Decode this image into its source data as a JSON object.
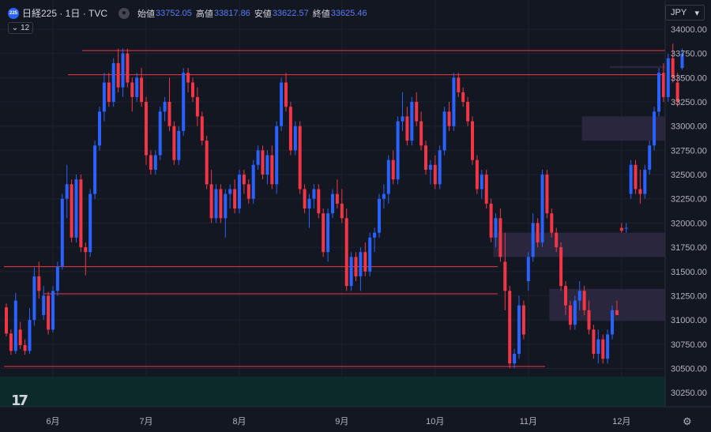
{
  "header": {
    "badge": "225",
    "title": "日経225 · 1日 · TVC",
    "eye_icon": "eye-icon",
    "open_label": "始値",
    "open_value": "33752.05",
    "high_label": "高値",
    "high_value": "33817.86",
    "low_label": "安値",
    "low_value": "33622.57",
    "close_label": "終値",
    "close_value": "33625.46",
    "interval_count": "12"
  },
  "currency_label": "JPY",
  "colors": {
    "up": "#2962ff",
    "down": "#f23645",
    "hline": "#f23645",
    "zone": "#2a2740",
    "background": "#131722",
    "grid": "#1e222d",
    "bottom_band": "#0d2a2a"
  },
  "chart_data": {
    "type": "candlestick",
    "title": "日経225",
    "ylim": [
      30100,
      34100
    ],
    "y_ticks": [
      34000,
      33750,
      33500,
      33250,
      33000,
      32750,
      32500,
      32250,
      32000,
      31750,
      31500,
      31250,
      31000,
      30750,
      30500,
      30250
    ],
    "y_tick_labels": [
      "34000.00",
      "33750.00",
      "33500.00",
      "33250.00",
      "33000.00",
      "32750.00",
      "32500.00",
      "32250.00",
      "32000.00",
      "31750.00",
      "31500.00",
      "31250.00",
      "31000.00",
      "30750.00",
      "30500.00",
      "30250.00"
    ],
    "x_ticks": [
      {
        "index": 10,
        "label": "6月"
      },
      {
        "index": 30,
        "label": "7月"
      },
      {
        "index": 50,
        "label": "8月"
      },
      {
        "index": 72,
        "label": "9月"
      },
      {
        "index": 92,
        "label": "10月"
      },
      {
        "index": 112,
        "label": "11月"
      },
      {
        "index": 132,
        "label": "12月"
      }
    ],
    "candles": [
      [
        31130,
        31170,
        30830,
        30860
      ],
      [
        30860,
        30900,
        30640,
        30680
      ],
      [
        30680,
        31280,
        30650,
        31200
      ],
      [
        30900,
        30980,
        30700,
        30740
      ],
      [
        30740,
        30800,
        30640,
        30680
      ],
      [
        30680,
        31120,
        30650,
        31000
      ],
      [
        31000,
        31540,
        30940,
        31450
      ],
      [
        31450,
        31600,
        31220,
        31300
      ],
      [
        31050,
        31350,
        31000,
        31250
      ],
      [
        31250,
        31290,
        30850,
        30900
      ],
      [
        30900,
        31350,
        30870,
        31300
      ],
      [
        31300,
        31600,
        31250,
        31550
      ],
      [
        31550,
        32300,
        31520,
        32250
      ],
      [
        32250,
        32600,
        32050,
        32400
      ],
      [
        32400,
        32450,
        31800,
        31850
      ],
      [
        31850,
        32500,
        31800,
        32450
      ],
      [
        32450,
        32500,
        31700,
        31750
      ],
      [
        31750,
        31800,
        31460,
        31700
      ],
      [
        31700,
        32350,
        31650,
        32300
      ],
      [
        32300,
        32850,
        32250,
        32800
      ],
      [
        32800,
        33200,
        32750,
        33150
      ],
      [
        33150,
        33550,
        33050,
        33450
      ],
      [
        33450,
        33550,
        33200,
        33250
      ],
      [
        33250,
        33700,
        33200,
        33650
      ],
      [
        33650,
        33800,
        33350,
        33400
      ],
      [
        33400,
        33800,
        33300,
        33750
      ],
      [
        33750,
        33800,
        33400,
        33450
      ],
      [
        33450,
        33500,
        33150,
        33300
      ],
      [
        33300,
        33550,
        33250,
        33500
      ],
      [
        33500,
        33600,
        33200,
        33250
      ],
      [
        33250,
        33300,
        32600,
        32700
      ],
      [
        32700,
        32750,
        32500,
        32550
      ],
      [
        32550,
        32750,
        32500,
        32700
      ],
      [
        32700,
        33200,
        32650,
        33150
      ],
      [
        33150,
        33300,
        33050,
        33250
      ],
      [
        33250,
        33500,
        32950,
        33000
      ],
      [
        33000,
        33050,
        32600,
        32650
      ],
      [
        32650,
        33000,
        32600,
        32950
      ],
      [
        32950,
        33600,
        32900,
        33550
      ],
      [
        33550,
        33600,
        33350,
        33450
      ],
      [
        33450,
        33500,
        33250,
        33300
      ],
      [
        33300,
        33400,
        33000,
        33100
      ],
      [
        33100,
        33150,
        32800,
        32850
      ],
      [
        32850,
        32900,
        32350,
        32400
      ],
      [
        32400,
        32550,
        32000,
        32050
      ],
      [
        32050,
        32400,
        32000,
        32350
      ],
      [
        32350,
        32400,
        32000,
        32050
      ],
      [
        32050,
        32350,
        31850,
        32300
      ],
      [
        32300,
        32400,
        32150,
        32350
      ],
      [
        32350,
        32450,
        32100,
        32150
      ],
      [
        32150,
        32550,
        32100,
        32500
      ],
      [
        32500,
        32550,
        32300,
        32400
      ],
      [
        32400,
        32450,
        32200,
        32250
      ],
      [
        32250,
        32650,
        32200,
        32600
      ],
      [
        32600,
        32800,
        32550,
        32750
      ],
      [
        32750,
        32800,
        32450,
        32500
      ],
      [
        32500,
        32750,
        32400,
        32700
      ],
      [
        32700,
        32800,
        32350,
        32400
      ],
      [
        32400,
        33050,
        32300,
        33000
      ],
      [
        33000,
        33500,
        32950,
        33450
      ],
      [
        33450,
        33550,
        33150,
        33200
      ],
      [
        33200,
        33250,
        32700,
        32750
      ],
      [
        32750,
        33050,
        32700,
        33000
      ],
      [
        33000,
        33050,
        32300,
        32350
      ],
      [
        32350,
        32400,
        32100,
        32150
      ],
      [
        32150,
        32300,
        31950,
        32250
      ],
      [
        32250,
        32400,
        32150,
        32350
      ],
      [
        32350,
        32400,
        32050,
        32100
      ],
      [
        32100,
        32150,
        31650,
        31700
      ],
      [
        31700,
        32150,
        31600,
        32100
      ],
      [
        32100,
        32350,
        32050,
        32300
      ],
      [
        32300,
        32450,
        32150,
        32200
      ],
      [
        32200,
        32350,
        32000,
        32050
      ],
      [
        32050,
        32150,
        31300,
        31350
      ],
      [
        31350,
        31700,
        31300,
        31650
      ],
      [
        31650,
        31700,
        31400,
        31450
      ],
      [
        31450,
        31750,
        31300,
        31700
      ],
      [
        31700,
        31800,
        31450,
        31500
      ],
      [
        31500,
        31900,
        31450,
        31850
      ],
      [
        31850,
        31950,
        31700,
        31900
      ],
      [
        31900,
        32300,
        31850,
        32250
      ],
      [
        32250,
        32400,
        32150,
        32300
      ],
      [
        32300,
        32700,
        32200,
        32650
      ],
      [
        32650,
        32750,
        32400,
        32450
      ],
      [
        32450,
        33100,
        32400,
        33050
      ],
      [
        33050,
        33350,
        32950,
        33100
      ],
      [
        33100,
        33200,
        32800,
        32850
      ],
      [
        32850,
        33300,
        32800,
        33250
      ],
      [
        33250,
        33350,
        33000,
        33050
      ],
      [
        33050,
        33150,
        32750,
        32800
      ],
      [
        32800,
        32850,
        32500,
        32550
      ],
      [
        32550,
        32650,
        32400,
        32600
      ],
      [
        32600,
        32700,
        32350,
        32400
      ],
      [
        32400,
        32800,
        32350,
        32750
      ],
      [
        32750,
        33200,
        32700,
        33150
      ],
      [
        33150,
        33250,
        32950,
        33000
      ],
      [
        33000,
        33550,
        32950,
        33500
      ],
      [
        33500,
        33550,
        33300,
        33350
      ],
      [
        33350,
        33400,
        33200,
        33250
      ],
      [
        33250,
        33300,
        33000,
        33050
      ],
      [
        33050,
        33100,
        32600,
        32650
      ],
      [
        32650,
        32700,
        32300,
        32350
      ],
      [
        32350,
        32550,
        32250,
        32500
      ],
      [
        32500,
        32550,
        32150,
        32200
      ],
      [
        32200,
        32250,
        31800,
        31850
      ],
      [
        31850,
        32100,
        31750,
        32050
      ],
      [
        32050,
        32150,
        31600,
        31650
      ],
      [
        31600,
        31900,
        31100,
        31300
      ],
      [
        31300,
        31350,
        30500,
        30550
      ],
      [
        30550,
        30700,
        30500,
        30650
      ],
      [
        30650,
        31250,
        30600,
        31150
      ],
      [
        31150,
        31200,
        30800,
        30850
      ],
      [
        31400,
        31700,
        31300,
        31650
      ],
      [
        31650,
        32100,
        31600,
        32000
      ],
      [
        32000,
        32050,
        31750,
        31800
      ],
      [
        31800,
        32550,
        31750,
        32500
      ],
      [
        32500,
        32550,
        32050,
        32100
      ],
      [
        32100,
        32150,
        31850,
        31900
      ],
      [
        31900,
        31950,
        31700,
        31750
      ],
      [
        31750,
        31800,
        31300,
        31350
      ],
      [
        31350,
        31400,
        31050,
        31150
      ],
      [
        31150,
        31200,
        30900,
        30950
      ],
      [
        30950,
        31250,
        30900,
        31200
      ],
      [
        31200,
        31400,
        31100,
        31300
      ],
      [
        31300,
        31350,
        31050,
        31100
      ],
      [
        31100,
        31200,
        30850,
        30900
      ],
      [
        30900,
        30950,
        30600,
        30650
      ],
      [
        30650,
        30900,
        30550,
        30800
      ],
      [
        30800,
        30850,
        30550,
        30600
      ],
      [
        30600,
        30900,
        30550,
        30850
      ],
      [
        30850,
        31150,
        30800,
        31100
      ],
      [
        31100,
        31200,
        31050,
        31050
      ],
      [
        31950,
        32000,
        31900,
        31920
      ],
      [
        31950,
        32000,
        31900,
        31950
      ],
      [
        32300,
        32650,
        32250,
        32600
      ],
      [
        32600,
        32650,
        32300,
        32350
      ],
      [
        32350,
        32550,
        32200,
        32300
      ],
      [
        32300,
        32600,
        32250,
        32550
      ],
      [
        32550,
        32850,
        32500,
        32800
      ],
      [
        32800,
        33200,
        32750,
        33150
      ],
      [
        33150,
        33600,
        33100,
        33550
      ],
      [
        33550,
        33650,
        33250,
        33300
      ],
      [
        33300,
        33750,
        33250,
        33700
      ],
      [
        33700,
        33850,
        33450,
        33500
      ],
      [
        33450,
        33550,
        33200,
        33250
      ],
      [
        33600,
        33800,
        33580,
        33750
      ]
    ],
    "horizontal_lines": [
      33780,
      33530,
      31550,
      31270,
      30520
    ],
    "zones": [
      {
        "from_index": 124,
        "y_top": 33100,
        "y_bottom": 32850
      },
      {
        "from_index": 105,
        "y_top": 31900,
        "y_bottom": 31650
      },
      {
        "from_index": 117,
        "y_top": 31320,
        "y_bottom": 30990
      },
      {
        "from_index": 130,
        "y_top": 33620,
        "y_bottom": 33600
      }
    ]
  }
}
